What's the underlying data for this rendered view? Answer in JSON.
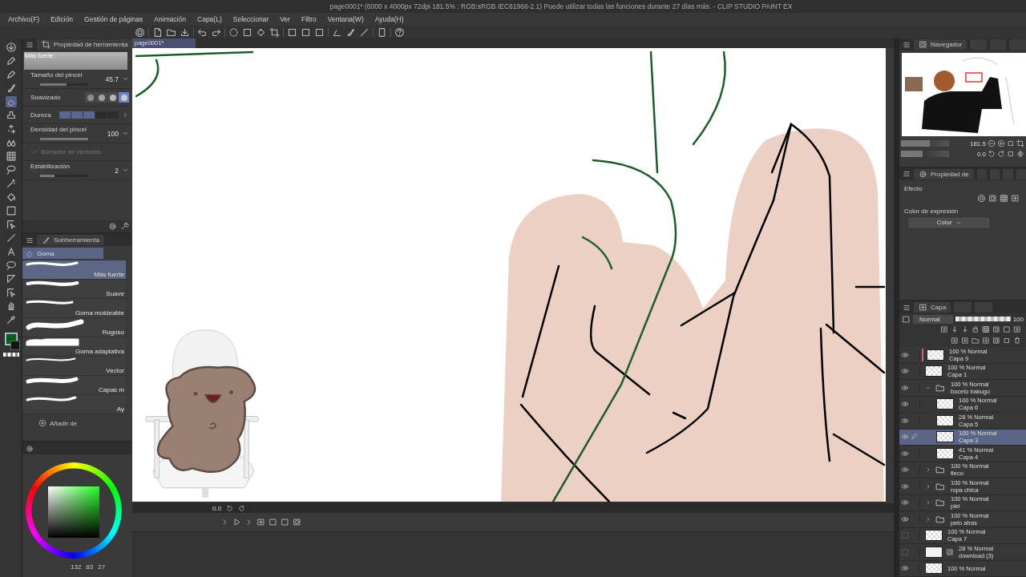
{
  "window": {
    "title": "page0001* (6000 x 4000px 72dpi 181.5% : RGB:sRGB IEC61966-2.1)  Puede utilizar todas las funciones durante 27 días más. - CLIP STUDIO PAINT EX"
  },
  "menu": [
    "Archivo(F)",
    "Edición",
    "Gestión de páginas",
    "Animación",
    "Capa(L)",
    "Seleccionar",
    "Ver",
    "Filtro",
    "Ventana(W)",
    "Ayuda(H)"
  ],
  "tool_property": {
    "tab": "Propiedad de herramienta",
    "preview_label": "Más fuerte",
    "rows": [
      {
        "kind": "slider",
        "label": "Tamaño del pincel",
        "value": "45.7",
        "level": 0.55
      },
      {
        "kind": "options",
        "label": "Suavizado",
        "options": [
          {
            "selected": false
          },
          {
            "selected": false
          },
          {
            "selected": false
          },
          {
            "selected": true
          }
        ]
      },
      {
        "kind": "segments",
        "label": "Dureza",
        "level": 0.6
      },
      {
        "kind": "slider",
        "label": "Densidad del pincel",
        "value": "100",
        "level": 1
      },
      {
        "kind": "checkbox",
        "label": "Borrador de vectores",
        "checked": true,
        "disabled": true
      },
      {
        "kind": "slider",
        "label": "Estabilización",
        "value": "2",
        "level": 0.3
      }
    ]
  },
  "subtool": {
    "tab": "Subherramienta",
    "group": "Goma",
    "items": [
      {
        "label": "Más fuerte",
        "selected": true
      },
      {
        "label": "Suave",
        "selected": false
      },
      {
        "label": "Goma moldeable",
        "selected": false
      },
      {
        "label": "Rugoso",
        "selected": false
      },
      {
        "label": "Goma adaptativa",
        "selected": false
      },
      {
        "label": "Vector",
        "selected": false
      },
      {
        "label": "Capas m",
        "selected": false
      },
      {
        "label": "Ay",
        "selected": false
      }
    ],
    "add_label": "Añadir de"
  },
  "colors": [
    {
      "kind": "main",
      "color": "#0d5c1d",
      "selected": true
    },
    {
      "kind": "sub",
      "color": "#151515",
      "selected": false
    }
  ],
  "color_panel": {
    "readouts": [
      "132",
      "83",
      "27"
    ]
  },
  "canvas": {
    "tabs": [
      {
        "label": "page0001*",
        "selected": true
      }
    ]
  },
  "timeline": {
    "frame": "0.0"
  },
  "navigator": {
    "tab": "Navegador",
    "zoom": {
      "value": "181.5",
      "level": 0.6
    },
    "angle": {
      "value": "0.0",
      "level": 0.45
    }
  },
  "layer_property": {
    "tab": "Propiedad de",
    "effect_label": "Efecto",
    "expression_label": "Color de expresión",
    "expression_value": "Color"
  },
  "layers": {
    "tab": "Capa",
    "blend": "Normal",
    "opacity": {
      "value": "100",
      "level": 1
    },
    "items": [
      {
        "kind": "layer",
        "mode": "100 % Normal",
        "name": "Capa 9",
        "visible": true,
        "selected": false,
        "color": "#d0606e"
      },
      {
        "kind": "layer",
        "mode": "100 % Normal",
        "name": "Capa 1",
        "visible": true,
        "selected": false
      },
      {
        "kind": "folder",
        "mode": "100 % Normal",
        "name": "boceto bakugo",
        "visible": true,
        "selected": false,
        "expanded": true,
        "children": [
          {
            "kind": "layer",
            "mode": "100 % Normal",
            "name": "Capa 6",
            "visible": true,
            "selected": false
          },
          {
            "kind": "layer",
            "mode": "28 % Normal",
            "name": "Capa 5",
            "visible": true,
            "selected": false
          },
          {
            "kind": "layer",
            "mode": "100 % Normal",
            "name": "Capa 3",
            "visible": true,
            "selected": true
          },
          {
            "kind": "layer",
            "mode": "41 % Normal",
            "name": "Capa 4",
            "visible": true,
            "selected": false
          }
        ]
      },
      {
        "kind": "folder",
        "mode": "100 % Normal",
        "name": "fleco",
        "visible": true,
        "selected": false,
        "expanded": false
      },
      {
        "kind": "folder",
        "mode": "100 % Normal",
        "name": "ropa chica",
        "visible": true,
        "selected": false,
        "expanded": false
      },
      {
        "kind": "folder",
        "mode": "100 % Normal",
        "name": "piel",
        "visible": true,
        "selected": false,
        "expanded": false
      },
      {
        "kind": "folder",
        "mode": "100 % Normal",
        "name": "pelo atras",
        "visible": true,
        "selected": false,
        "expanded": false
      },
      {
        "kind": "layer",
        "mode": "100 % Normal",
        "name": "Capa 7",
        "visible": false,
        "selected": false
      },
      {
        "kind": "image",
        "mode": "28 % Normal",
        "name": "download (3)",
        "visible": false,
        "selected": false
      },
      {
        "kind": "layer",
        "mode": "100 % Normal",
        "visible": true,
        "selected": false
      }
    ]
  }
}
